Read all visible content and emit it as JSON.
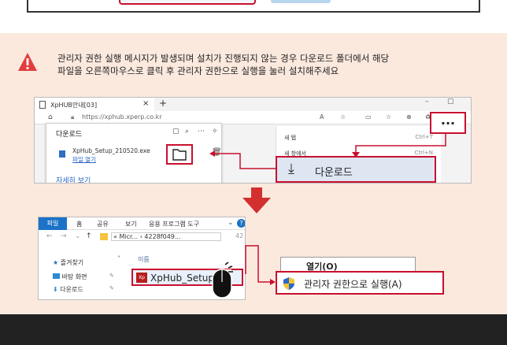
{
  "notice": {
    "line1": "관리자 권한 실행 메시지가 발생되며 설치가 진행되지 않는 경우 다운로드 폴더에서 해당",
    "line2": "파일을 오른쪽마우스로 클릭 후 관리자 권한으로 실행을 눌러 설치해주세요"
  },
  "browser": {
    "tab_title": "XpHUB안내[03]",
    "tab_close": "×",
    "new_tab": "+",
    "minimize": "–",
    "restore": "▢",
    "url": "https://xphub.xperp.co.kr",
    "downloads": {
      "title": "다운로드",
      "file_name": "XpHub_Setup_210520.exe",
      "open_file": "파일 열기",
      "see_more": "자세히 보기"
    },
    "menu": {
      "items": [
        {
          "label": "새 탭",
          "shortcut": "Ctrl+T"
        },
        {
          "label": "새 창에서",
          "shortcut": "Ctrl+N"
        }
      ],
      "more_label": "...",
      "download_label": "다운로드"
    }
  },
  "explorer": {
    "ribbon": [
      "파일",
      "홈",
      "공유",
      "보기",
      "응용 프로그램 도구"
    ],
    "path": "« Micr... › 4228f049...",
    "path_end": "42",
    "sidebar": [
      "즐겨찾기",
      "바탕 화면",
      "다운로드"
    ],
    "column_header": "이름",
    "file_name": "XpHub_Setup",
    "file_icon_text": "Xp"
  },
  "context_menu": {
    "open": "열기(O)",
    "run_as_admin": "관리자 권한으로 실행(A)"
  },
  "colors": {
    "accent_red": "#c8102e",
    "background": "#fbe9de",
    "footer": "#212121"
  }
}
